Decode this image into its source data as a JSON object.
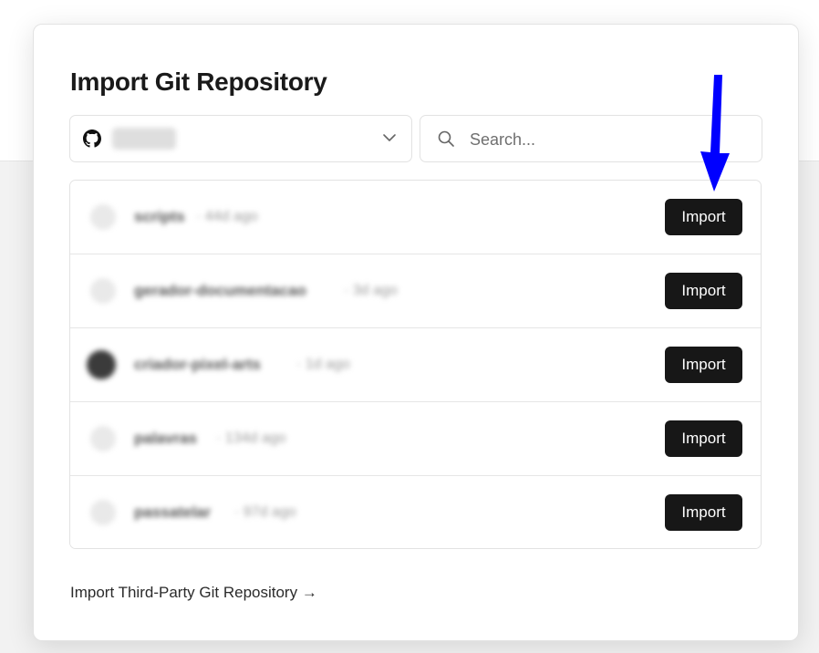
{
  "dialog": {
    "title": "Import Git Repository",
    "account": {
      "icon": "github-icon",
      "name": "user"
    },
    "search": {
      "placeholder": "Search...",
      "value": ""
    },
    "repositories": [
      {
        "name": "scripts",
        "meta": "· 44d ago",
        "avatar": "light",
        "import_label": "Import"
      },
      {
        "name": "gerador-documentacao",
        "meta": "· 3d ago",
        "avatar": "light",
        "import_label": "Import"
      },
      {
        "name": "criador-pixel-arts",
        "meta": "· 1d ago",
        "avatar": "dark",
        "import_label": "Import"
      },
      {
        "name": "palavras",
        "meta": "· 134d ago",
        "avatar": "light",
        "import_label": "Import"
      },
      {
        "name": "passatelar",
        "meta": "· 97d ago",
        "avatar": "light",
        "import_label": "Import"
      }
    ],
    "third_party_link": "Import Third-Party Git Repository →"
  },
  "annotation": {
    "icon": "down-arrow-icon",
    "color": "#0000ff"
  },
  "colors": {
    "button": "#171717",
    "annotation_arrow": "#0000ff"
  }
}
